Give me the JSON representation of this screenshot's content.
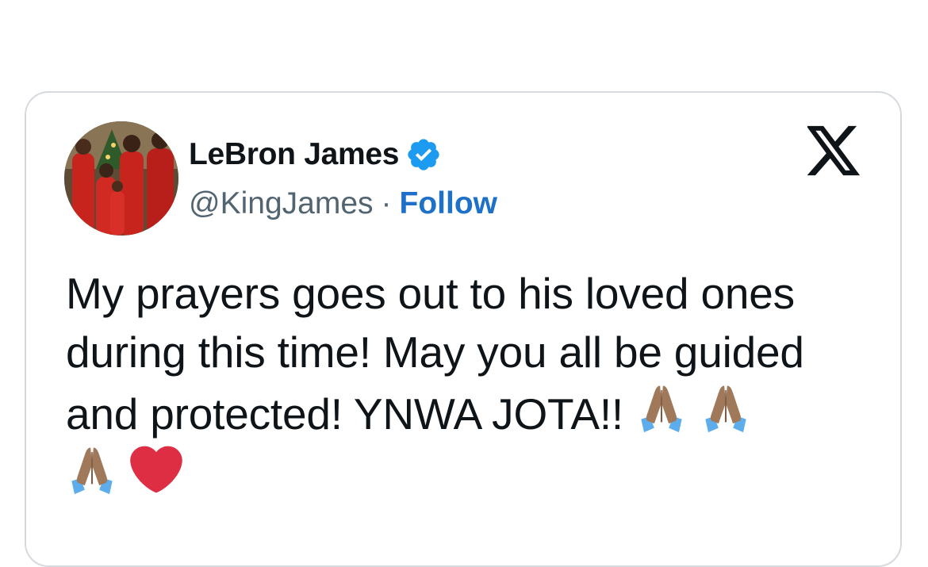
{
  "tweet": {
    "author": {
      "display_name": "LeBron James",
      "handle": "@KingJames",
      "separator": "·",
      "follow_label": "Follow",
      "verified": true
    },
    "text": "My prayers goes out to his loved ones during this time! May you all be guided and protected! YNWA JOTA!!",
    "trailing_emojis": [
      "folded-hands-medium-dark",
      "folded-hands-medium-dark",
      "folded-hands-medium-dark",
      "red-heart"
    ]
  },
  "icons": {
    "verified_badge": "verified-check-icon",
    "platform_logo": "x-logo-icon"
  },
  "colors": {
    "text": "#0f1419",
    "secondary": "#536471",
    "follow": "#1d71c8",
    "verified": "#1d9bf0",
    "card_border": "#d6dade"
  }
}
